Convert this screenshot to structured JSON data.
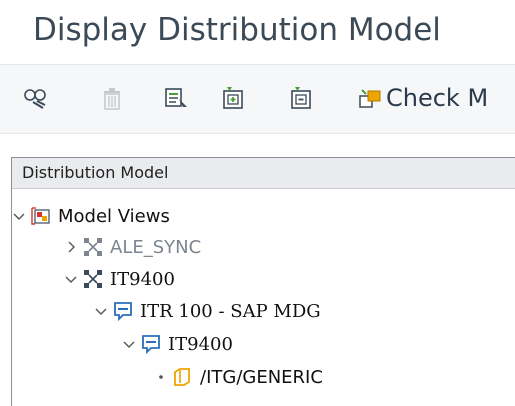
{
  "window": {
    "title": "Display Distribution Model"
  },
  "toolbar": {
    "buttons": [
      {
        "icon": "glasses-icon",
        "enabled": true
      },
      {
        "icon": "trash-icon",
        "enabled": false
      },
      {
        "icon": "select-icon",
        "enabled": true
      },
      {
        "icon": "expand-icon",
        "enabled": true
      },
      {
        "icon": "collapse-icon",
        "enabled": true
      }
    ],
    "check_label": "Check M"
  },
  "panel": {
    "header": "Distribution Model",
    "tree": [
      {
        "label": "Model Views",
        "level": 0,
        "expanded": true,
        "icon": "model-views-icon"
      },
      {
        "label": "ALE_SYNC",
        "level": 1,
        "expanded": false,
        "icon": "model-view-icon",
        "muted": true
      },
      {
        "label": "IT9400",
        "level": 1,
        "expanded": true,
        "icon": "model-view-icon"
      },
      {
        "label": "ITR 100 - SAP MDG",
        "level": 2,
        "expanded": true,
        "icon": "system-icon"
      },
      {
        "label": "IT9400",
        "level": 3,
        "expanded": true,
        "icon": "system-icon"
      },
      {
        "label": "/ITG/GENERIC",
        "level": 4,
        "expanded": null,
        "icon": "folder-icon"
      }
    ]
  },
  "colors": {
    "title": "#3c4a57",
    "panel_header_bg": "#e9ebed",
    "accent_blue": "#2a6ebb",
    "accent_green": "#4a9e3a",
    "accent_red": "#d9342b",
    "accent_orange": "#f0a400"
  }
}
